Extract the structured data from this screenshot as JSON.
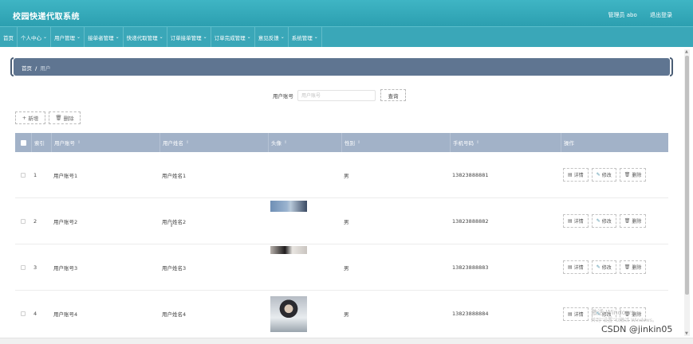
{
  "header": {
    "brand": "校园快递代取系统",
    "user_label": "管理员 abo",
    "logout_label": "退出登录"
  },
  "nav": {
    "items": [
      {
        "label": "首页",
        "chevron": false
      },
      {
        "label": "个人中心",
        "chevron": true
      },
      {
        "label": "用户管理",
        "chevron": true
      },
      {
        "label": "接单者管理",
        "chevron": true
      },
      {
        "label": "快递代取管理",
        "chevron": true
      },
      {
        "label": "订单接单管理",
        "chevron": true
      },
      {
        "label": "订单完成管理",
        "chevron": true
      },
      {
        "label": "意见反馈",
        "chevron": true
      },
      {
        "label": "系统管理",
        "chevron": true
      }
    ]
  },
  "breadcrumb": {
    "home": "首页",
    "separator": "/",
    "current": "用户"
  },
  "search": {
    "label": "用户账号",
    "placeholder": "用户账号",
    "value": "",
    "button_label": "查询"
  },
  "actions": {
    "add_label": "新增",
    "delete_label": "删除"
  },
  "table": {
    "columns": [
      "索引",
      "用户账号",
      "用户姓名",
      "头像",
      "性别",
      "手机号码",
      "操作"
    ],
    "sort_icon": "⇕",
    "rows": [
      {
        "index": "1",
        "account": "用户账号1",
        "name": "用户姓名1",
        "gender": "男",
        "phone": "13823888881",
        "avatar": ""
      },
      {
        "index": "2",
        "account": "用户账号2",
        "name": "用户姓名2",
        "gender": "男",
        "phone": "13823888882",
        "avatar": "a2"
      },
      {
        "index": "3",
        "account": "用户账号3",
        "name": "用户姓名3",
        "gender": "男",
        "phone": "13823888883",
        "avatar": "a3"
      },
      {
        "index": "4",
        "account": "用户账号4",
        "name": "用户姓名4",
        "gender": "男",
        "phone": "13823888884",
        "avatar": "a4"
      }
    ],
    "row_actions": {
      "detail": "详情",
      "edit": "修改",
      "delete": "删除"
    }
  },
  "overlay": {
    "windows_line1": "激活 Windows",
    "windows_line2": "转到“设置”以激活 Windows。",
    "csdn": "CSDN @jinkin05"
  },
  "icons": {
    "add": "plus-icon",
    "delete": "trash-icon",
    "detail": "doc-icon",
    "edit": "pencil-icon"
  }
}
